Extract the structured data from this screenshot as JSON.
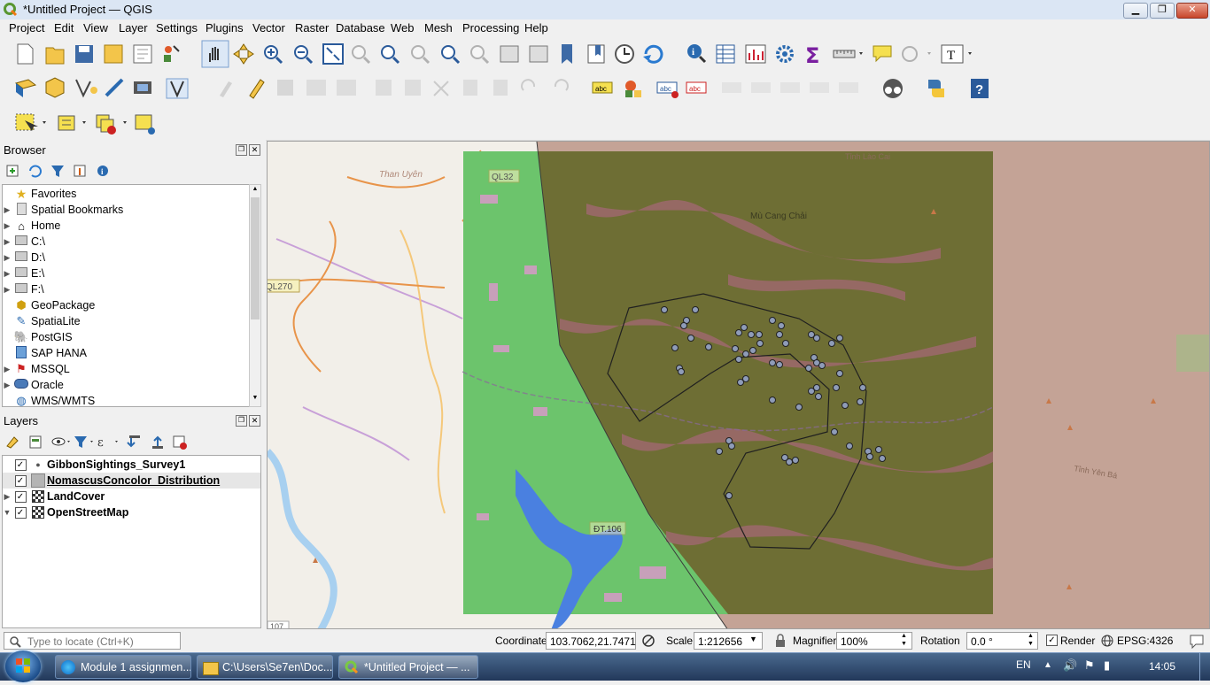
{
  "window": {
    "title": "*Untitled Project — QGIS"
  },
  "menu": [
    "Project",
    "Edit",
    "View",
    "Layer",
    "Settings",
    "Plugins",
    "Vector",
    "Raster",
    "Database",
    "Web",
    "Mesh",
    "Processing",
    "Help"
  ],
  "browser": {
    "title": "Browser",
    "items": [
      {
        "label": "Favorites",
        "icon": "star-icon",
        "expand": false
      },
      {
        "label": "Spatial Bookmarks",
        "icon": "bookmark-icon",
        "expand": true
      },
      {
        "label": "Home",
        "icon": "home-icon",
        "expand": true
      },
      {
        "label": "C:\\",
        "icon": "drive-icon",
        "expand": true
      },
      {
        "label": "D:\\",
        "icon": "drive-icon",
        "expand": true
      },
      {
        "label": "E:\\",
        "icon": "drive-icon",
        "expand": true
      },
      {
        "label": "F:\\",
        "icon": "drive-icon",
        "expand": true
      },
      {
        "label": "GeoPackage",
        "icon": "geopackage-icon",
        "expand": false
      },
      {
        "label": "SpatiaLite",
        "icon": "spatialite-icon",
        "expand": false
      },
      {
        "label": "PostGIS",
        "icon": "postgis-icon",
        "expand": false
      },
      {
        "label": "SAP HANA",
        "icon": "sap-hana-icon",
        "expand": false
      },
      {
        "label": "MSSQL",
        "icon": "mssql-icon",
        "expand": true
      },
      {
        "label": "Oracle",
        "icon": "oracle-icon",
        "expand": true
      },
      {
        "label": "WMS/WMTS",
        "icon": "wms-icon",
        "expand": false
      }
    ]
  },
  "layers": {
    "title": "Layers",
    "items": [
      {
        "label": "GibbonSightings_Survey1",
        "checked": true,
        "expand": false,
        "icon": "point-layer-icon"
      },
      {
        "label": "NomascusConcolor_Distribution",
        "checked": true,
        "expand": false,
        "icon": "polygon-layer-icon",
        "selected": true
      },
      {
        "label": "LandCover",
        "checked": true,
        "expand": true,
        "icon": "raster-layer-icon"
      },
      {
        "label": "OpenStreetMap",
        "checked": true,
        "expand": true,
        "icon": "raster-layer-icon",
        "open": true
      }
    ]
  },
  "map": {
    "labels": {
      "than_uyen": "Than Uyên",
      "ql32": "QL32",
      "ql270": "QL270",
      "mu_cang_chai": "Mù Cang Chải",
      "dt106": "ĐT.106",
      "tinh_lao_cai": "Tỉnh Lào Cai",
      "tinh_yen_bai": "Tỉnh Yên Bá",
      "r107": "107"
    }
  },
  "status": {
    "locate_placeholder": "Type to locate (Ctrl+K)",
    "coordinate_label": "Coordinate",
    "coordinate_value": "103.7062,21.7471",
    "scale_label": "Scale",
    "scale_value": "1:212656",
    "magnifier_label": "Magnifier",
    "magnifier_value": "100%",
    "rotation_label": "Rotation",
    "rotation_value": "0.0 °",
    "render_label": "Render",
    "crs": "EPSG:4326"
  },
  "taskbar": {
    "items": [
      {
        "label": "Module 1 assignmen...",
        "icon": "edge-icon"
      },
      {
        "label": "C:\\Users\\Se7en\\Doc...",
        "icon": "folder-icon"
      },
      {
        "label": "*Untitled Project — ...",
        "icon": "qgis-icon"
      }
    ],
    "lang": "EN",
    "time": "14:05"
  }
}
